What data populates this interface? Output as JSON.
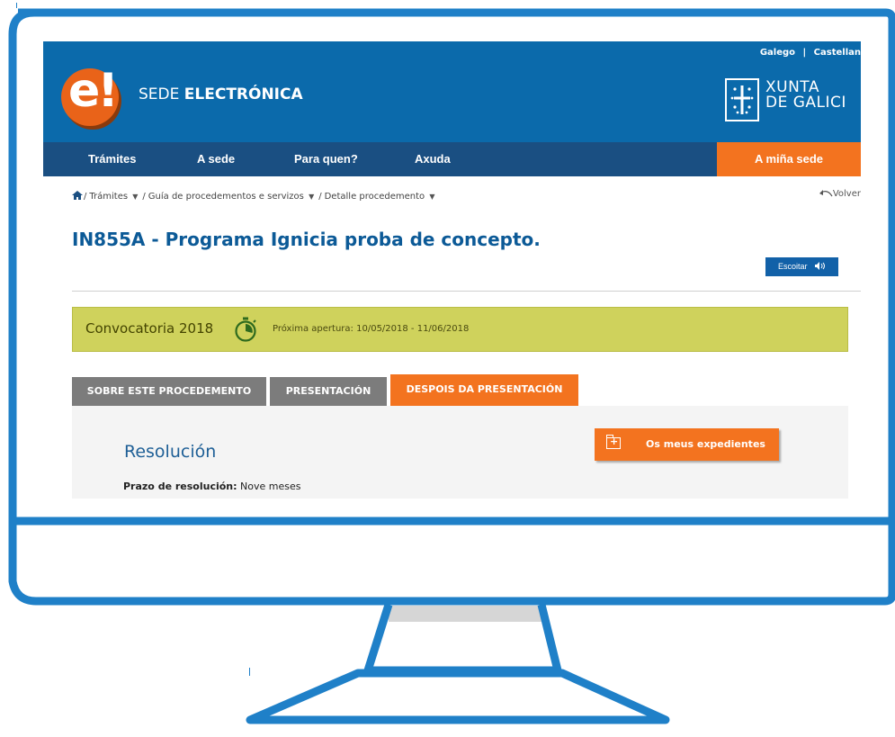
{
  "colors": {
    "monitor_frame": "#1f80c8",
    "header_bg": "#0b6aab",
    "nav_bg": "#1a4f82",
    "accent_orange": "#f3731f",
    "banner_bg": "#cfd25c",
    "title_blue": "#0c5a97"
  },
  "header": {
    "lang_galego": "Galego",
    "lang_separator": "|",
    "lang_castellano": "Castellan",
    "logo_glyph": "e!",
    "brand_prefix": "SEDE",
    "brand_main": "ELECTRÓNICA",
    "xunta_line1": "XUNTA",
    "xunta_line2": "DE GALICI",
    "xunta_emblem_icon": "xunta-emblem-icon"
  },
  "nav": {
    "items": [
      "Trámites",
      "A sede",
      "Para quen?",
      "Axuda"
    ],
    "my_sede": "A miña sede"
  },
  "breadcrumb": {
    "home_icon": "home-icon",
    "items": [
      "Trámites",
      "Guía de procedementos e servizos",
      "Detalle procedemento"
    ],
    "separator": "/",
    "back_label": "Volver",
    "back_icon": "back-arrow-icon"
  },
  "page": {
    "title": "IN855A - Programa Ignicia proba de concepto.",
    "listen_label": "Escoitar",
    "listen_icon": "speaker-icon"
  },
  "call": {
    "title": "Convocatoria 2018",
    "timer_icon": "stopwatch-icon",
    "dates_label": "Próxima apertura:",
    "dates_value": "10/05/2018 - 11/06/2018"
  },
  "tabs": [
    {
      "label": "SOBRE ESTE PROCEDEMENTO",
      "active": false
    },
    {
      "label": "PRESENTACIÓN",
      "active": false
    },
    {
      "label": "DESPOIS DA PRESENTACIÓN",
      "active": true
    }
  ],
  "panel": {
    "section_title": "Resolución",
    "deadline_label": "Prazo de resolución:",
    "deadline_value": "Nove meses",
    "files_button": "Os meus expedientes",
    "files_icon": "folder-plus-icon"
  }
}
